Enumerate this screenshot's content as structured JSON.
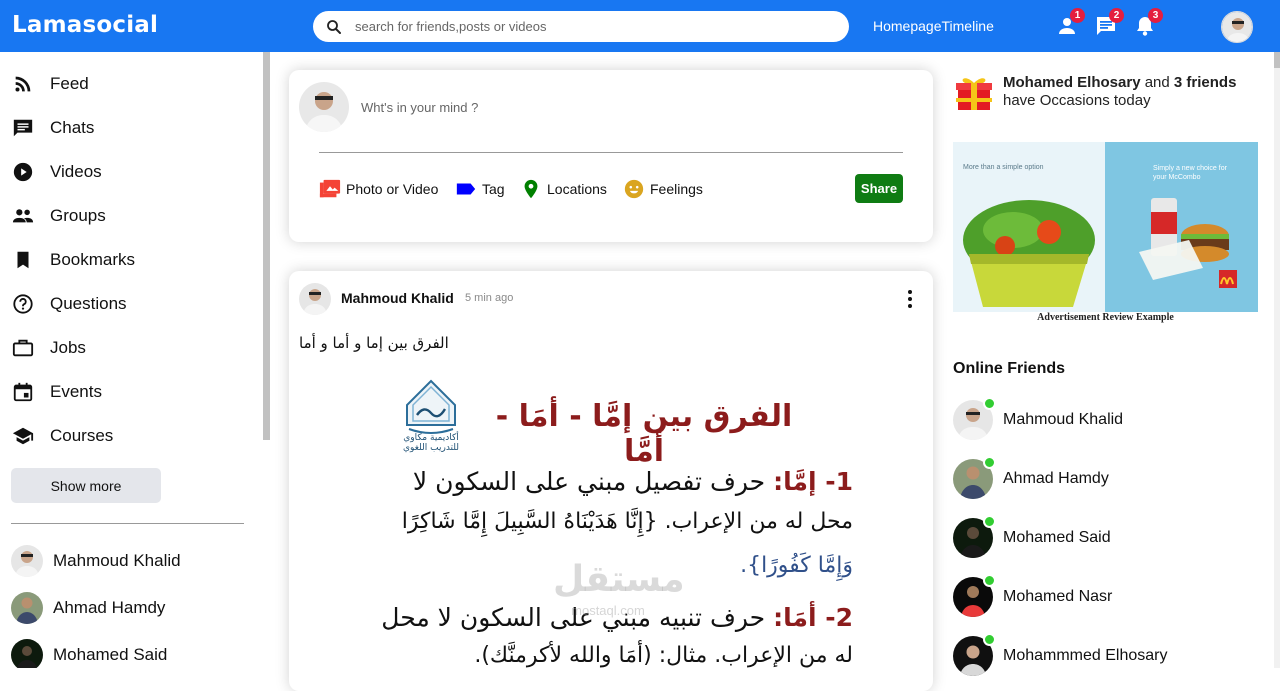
{
  "app": {
    "logo": "Lamasocial"
  },
  "search": {
    "placeholder": "search for friends,posts or videos",
    "icon": "search-icon"
  },
  "topbar": {
    "links": [
      "Homepage",
      "Timeline"
    ],
    "icons": [
      {
        "name": "person-icon",
        "badge": "1"
      },
      {
        "name": "chat-icon",
        "badge": "2"
      },
      {
        "name": "notifications-icon",
        "badge": "3"
      }
    ]
  },
  "sidebar": {
    "items": [
      {
        "label": "Feed",
        "icon": "rss-feed-icon"
      },
      {
        "label": "Chats",
        "icon": "chat-icon"
      },
      {
        "label": "Videos",
        "icon": "play-circle-icon"
      },
      {
        "label": "Groups",
        "icon": "group-icon"
      },
      {
        "label": "Bookmarks",
        "icon": "bookmark-icon"
      },
      {
        "label": "Questions",
        "icon": "help-outline-icon"
      },
      {
        "label": "Jobs",
        "icon": "work-outline-icon"
      },
      {
        "label": "Events",
        "icon": "event-icon"
      },
      {
        "label": "Courses",
        "icon": "school-icon"
      }
    ],
    "show_more": "Show more",
    "friends": [
      "Mahmoud Khalid",
      "Ahmad Hamdy",
      "Mohamed Said"
    ]
  },
  "share": {
    "placeholder": "Wht's in your mind ?",
    "options": [
      {
        "label": "Photo or Video",
        "icon": "perm-media-icon",
        "color": "#f44336"
      },
      {
        "label": "Tag",
        "icon": "label-icon",
        "color": "#0000ff"
      },
      {
        "label": "Locations",
        "icon": "room-icon",
        "color": "#008000"
      },
      {
        "label": "Feelings",
        "icon": "emoji-emotions-icon",
        "color": "#daa520"
      }
    ],
    "button": "Share",
    "button_color": "#0f7c13"
  },
  "post": {
    "username": "Mahmoud Khalid",
    "date": "5 min ago",
    "text": "الفرق بين إما و أما و أما",
    "image": {
      "title": "الفرق بين إمَّا - أمَا - أمَّا",
      "logo_caption": "أكاديمية مكاوي للتدريب اللغوي",
      "line1a": "1- إمَّا:",
      "line1b": "حرف تفصيل مبني على السكون لا",
      "line2": "محل له من الإعراب. {إِنَّا هَدَيْنَاهُ السَّبِيلَ إِمَّا شَاكِرًا",
      "line3": "وَإِمَّا كَفُورًا}.",
      "line4a": "2- أمَا:",
      "line4b": "حرف تنبيه مبني على السكون لا محل",
      "line5": "له من الإعراب. مثال: (أمَا والله لأكرمنَّك).",
      "watermark": "مستقل",
      "watermark_url": "mostaql.com"
    }
  },
  "rightbar": {
    "birthday": {
      "name": "Mohamed Elhosary",
      "middle": " and ",
      "count": "3 friends",
      "suffix": "have Occasions today"
    },
    "ad": {
      "left_caption": "More than a simple option",
      "right_caption": "Simply a new choice for your McCombo",
      "caption": "Advertisement Review Example"
    },
    "online_title": "Online Friends",
    "online_friends": [
      "Mahmoud Khalid",
      "Ahmad Hamdy",
      "Mohamed Said",
      "Mohamed Nasr",
      "Mohammmed Elhosary"
    ],
    "online_color": "#32cd32"
  }
}
